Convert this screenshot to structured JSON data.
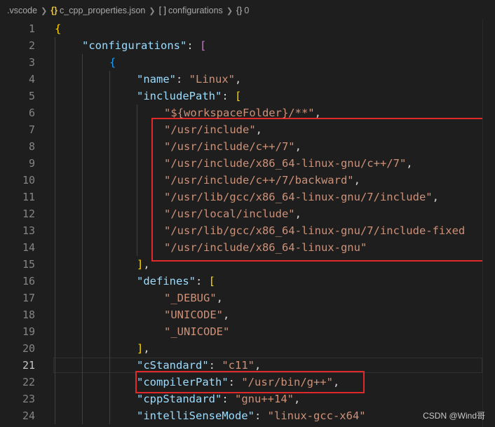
{
  "breadcrumb": {
    "folder": ".vscode",
    "file": "c_cpp_properties.json",
    "array": "configurations",
    "object": "0",
    "file_icon": "{}",
    "array_icon": "[ ]",
    "object_icon": "{}"
  },
  "lines": [
    {
      "n": "1",
      "code": "{"
    },
    {
      "n": "2",
      "code": "\"configurations\": ["
    },
    {
      "n": "3",
      "code": "{"
    },
    {
      "n": "4",
      "code": "\"name\": \"Linux\","
    },
    {
      "n": "5",
      "code": "\"includePath\": ["
    },
    {
      "n": "6",
      "code": "\"${workspaceFolder}/**\","
    },
    {
      "n": "7",
      "code": "\"/usr/include\","
    },
    {
      "n": "8",
      "code": "\"/usr/include/c++/7\","
    },
    {
      "n": "9",
      "code": "\"/usr/include/x86_64-linux-gnu/c++/7\","
    },
    {
      "n": "10",
      "code": "\"/usr/include/c++/7/backward\","
    },
    {
      "n": "11",
      "code": "\"/usr/lib/gcc/x86_64-linux-gnu/7/include\","
    },
    {
      "n": "12",
      "code": "\"/usr/local/include\","
    },
    {
      "n": "13",
      "code": "\"/usr/lib/gcc/x86_64-linux-gnu/7/include-fixed"
    },
    {
      "n": "14",
      "code": "\"/usr/include/x86_64-linux-gnu\""
    },
    {
      "n": "15",
      "code": "],"
    },
    {
      "n": "16",
      "code": "\"defines\": ["
    },
    {
      "n": "17",
      "code": "\"_DEBUG\","
    },
    {
      "n": "18",
      "code": "\"UNICODE\","
    },
    {
      "n": "19",
      "code": "\"_UNICODE\""
    },
    {
      "n": "20",
      "code": "],"
    },
    {
      "n": "21",
      "code": "\"cStandard\": \"c11\","
    },
    {
      "n": "22",
      "code": "\"compilerPath\": \"/usr/bin/g++\","
    },
    {
      "n": "23",
      "code": "\"cppStandard\": \"gnu++14\","
    },
    {
      "n": "24",
      "code": "\"intelliSenseMode\": \"linux-gcc-x64\""
    }
  ],
  "current_line": "21",
  "watermark": "CSDN @Wind哥",
  "colors": {
    "background": "#1e1e1e",
    "key": "#9cdcfe",
    "string": "#ce9178",
    "bracket_level1": "#ffd700",
    "bracket_level2": "#da70d6",
    "bracket_level3": "#179fff",
    "highlight_box": "#e0292b"
  }
}
